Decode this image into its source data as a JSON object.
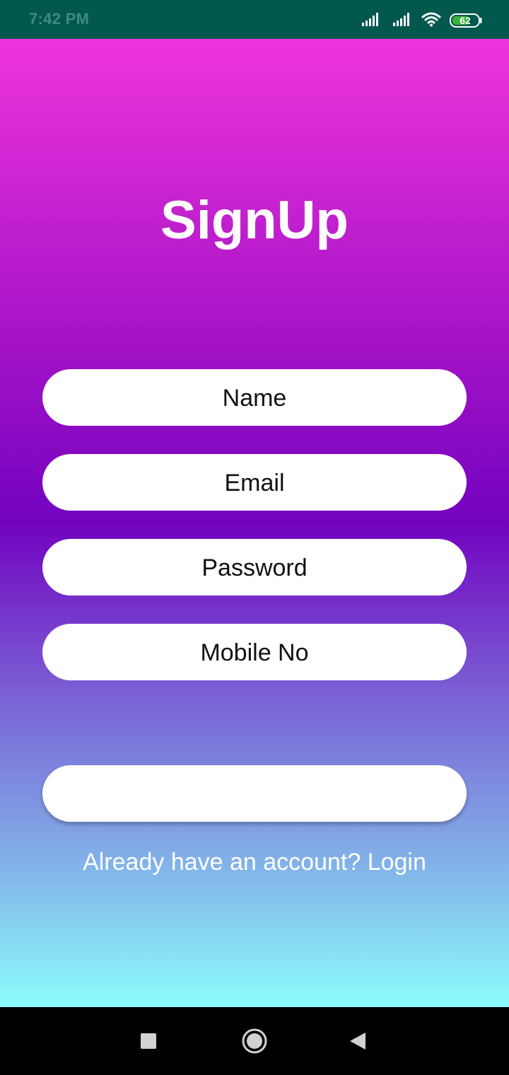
{
  "status_bar": {
    "time": "7:42 PM",
    "battery_level": "62"
  },
  "title": "SignUp",
  "form": {
    "name_placeholder": "Name",
    "email_placeholder": "Email",
    "password_placeholder": "Password",
    "mobile_placeholder": "Mobile No",
    "submit_label": ""
  },
  "login_prompt": "Already have an account? Login",
  "icons": {
    "signal": "cellular-signal-icon",
    "wifi": "wifi-icon",
    "battery": "battery-icon",
    "recent": "recent-apps-icon",
    "home": "home-icon",
    "back": "back-icon"
  },
  "colors": {
    "status_bar": "#02584d",
    "gradient_top": "#ee34dc",
    "gradient_mid": "#7203c0",
    "gradient_bottom": "#8cfcfb",
    "battery_fill": "#3bb33b",
    "field_background": "#ffffff"
  }
}
